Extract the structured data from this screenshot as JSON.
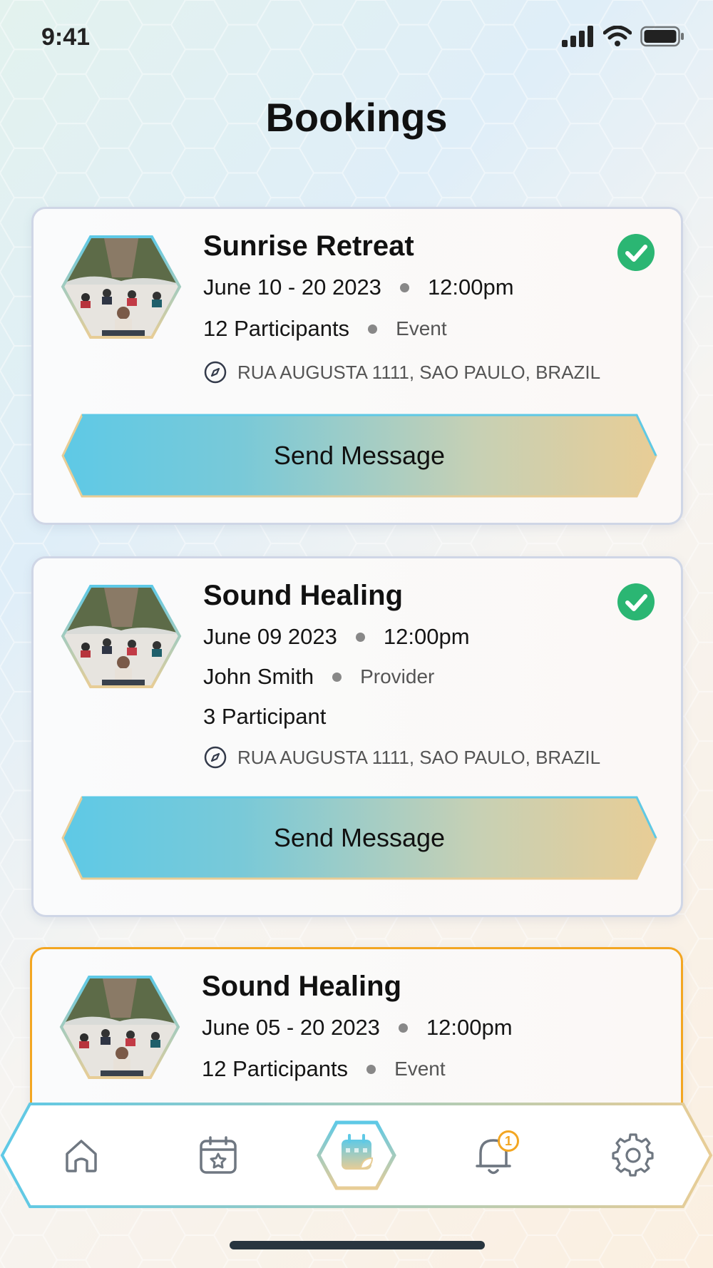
{
  "status_bar": {
    "time": "9:41"
  },
  "page": {
    "title": "Bookings"
  },
  "bookings": [
    {
      "title": "Sunrise Retreat",
      "date": "June 10 - 20 2023",
      "time": "12:00pm",
      "participants": "12 Participants",
      "type": "Event",
      "address": "RUA AUGUSTA 1111, SAO PAULO, BRAZIL",
      "button": "Send Message",
      "confirmed": true
    },
    {
      "title": "Sound Healing",
      "date": "June 09 2023",
      "time": "12:00pm",
      "person": "John Smith",
      "role": "Provider",
      "participants": "3 Participant",
      "address": "RUA AUGUSTA 1111, SAO PAULO, BRAZIL",
      "button": "Send Message",
      "confirmed": true
    },
    {
      "title": "Sound Healing",
      "date": "June 05 - 20 2023",
      "time": "12:00pm",
      "participants": "12 Participants",
      "type": "Event"
    }
  ],
  "nav": {
    "items": [
      "home-icon",
      "calendar-star-icon",
      "calendar-leaf-icon",
      "bell-icon",
      "gear-icon"
    ],
    "active": "calendar-leaf-icon",
    "notification_count": "1"
  },
  "colors": {
    "accent_blue": "#5ec9e6",
    "accent_sand": "#e8cd96",
    "check_green": "#2bb673",
    "highlight_orange": "#f3a622"
  }
}
